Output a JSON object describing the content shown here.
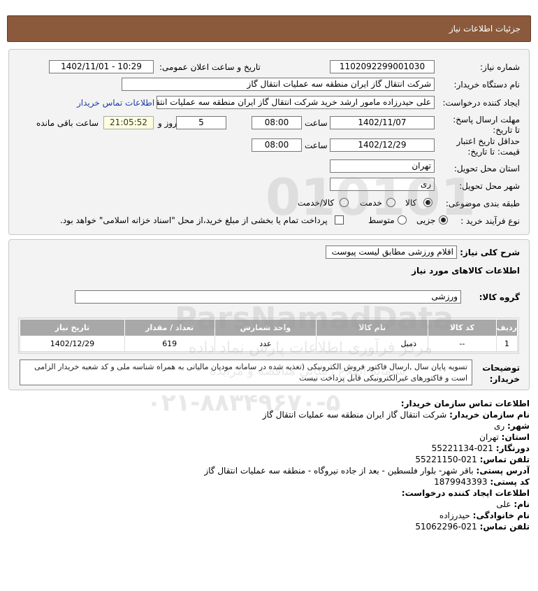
{
  "header": {
    "title": "جزئیات اطلاعات نیاز"
  },
  "form": {
    "need_number_label": "شماره نیاز:",
    "need_number": "1102092299001030",
    "announce_label": "تاریخ و ساعت اعلان عمومی:",
    "announce_value": "1402/11/01 - 10:29",
    "buyer_org_label": "نام دستگاه خریدار:",
    "buyer_org": "شرکت انتقال گاز ایران منطقه سه عملیات انتقال گاز",
    "creator_label": "ایجاد کننده درخواست:",
    "creator": "علی حیدرزاده مامور ارشد خرید شرکت انتقال گاز ایران منطقه سه عملیات انتقال",
    "contact_link": "اطلاعات تماس خریدار",
    "deadline_label": "مهلت ارسال پاسخ: تا تاریخ:",
    "deadline_date": "1402/11/07",
    "time_label": "ساعت",
    "deadline_time": "08:00",
    "days": "5",
    "days_label": "روز و",
    "remaining_time": "21:05:52",
    "remaining_label": "ساعت باقی مانده",
    "validity_label": "حداقل تاریخ اعتبار قیمت: تا تاریخ:",
    "validity_date": "1402/12/29",
    "validity_time": "08:00",
    "province_label": "استان محل تحویل:",
    "province": "تهران",
    "city_label": "شهر محل تحویل:",
    "city": "ری",
    "category_label": "طبقه بندی موضوعی:",
    "category_options": [
      "کالا",
      "خدمت",
      "کالا/خدمت"
    ],
    "process_label": "نوع فرآیند خرید :",
    "process_options": [
      "جزیی",
      "متوسط"
    ],
    "payment_note": "پرداخت تمام یا بخشی از مبلغ خرید،از محل \"اسناد خزانه اسلامی\" خواهد بود."
  },
  "need": {
    "summary_label": "شرح کلی نیاز:",
    "summary": "اقلام ورزشی مطابق لیست پیوست",
    "goods_title": "اطلاعات کالاهای مورد نیاز",
    "group_label": "گروه کالا:",
    "group": "ورزشی",
    "table": {
      "headers": [
        "ردیف",
        "کد کالا",
        "نام کالا",
        "واحد شمارش",
        "تعداد / مقدار",
        "تاریخ نیاز"
      ],
      "rows": [
        [
          "1",
          "--",
          "دمبل",
          "عدد",
          "619",
          "1402/12/29"
        ]
      ]
    },
    "buyer_notes_label": "توضیحات خریدار:",
    "buyer_notes": "تسویه پایان سال ,ارسال فاکتور فروش الکترونیکی (تغذیه شده در سامانه مودیان مالیاتی به همراه شناسه ملی و کد شعبه خریدار الزامی است و فاکتورهای غیرالکترونیکی قابل پرداخت نیست"
  },
  "contact": {
    "title": "اطلاعات تماس سازمان خریدار:",
    "org_k": "نام سازمان خریدار:",
    "org_v": "شرکت انتقال گاز ایران منطقه سه عملیات انتقال گاز",
    "city_k": "شهر:",
    "city_v": "ری",
    "province_k": "استان:",
    "province_v": "تهران",
    "fax_k": "دورنگار:",
    "fax_v": "021-55221134",
    "phone_k": "تلفن تماس:",
    "phone_v": "021-55221150",
    "address_k": "آدرس پستی:",
    "address_v": "باقر شهر- بلوار فلسطین - بعد از جاده نیروگاه - منطقه سه عملیات انتقال گاز",
    "postal_k": "کد پستی:",
    "postal_v": "1879943393",
    "creator_title": "اطلاعات ایجاد کننده درخواست:",
    "fname_k": "نام:",
    "fname_v": "علی",
    "lname_k": "نام خانوادگی:",
    "lname_v": "حیدرزاده",
    "cphone_k": "تلفن تماس:",
    "cphone_v": "021-51062296"
  },
  "watermark": {
    "brand": "ParsNamadData",
    "tagline": "مرکز فرآوری اطلاعات پارس نماد داده",
    "tagline2": "سامانه اطلاع رسانی مناقصه و مزایده",
    "phone": "۰۲۱-۸۸۳۴۹۶۷۰-۵",
    "big_number": "010101"
  },
  "colors": {
    "header_bg": "#8b5a3c",
    "link": "#1a3ea8",
    "table_header": "#a8a8a8"
  }
}
